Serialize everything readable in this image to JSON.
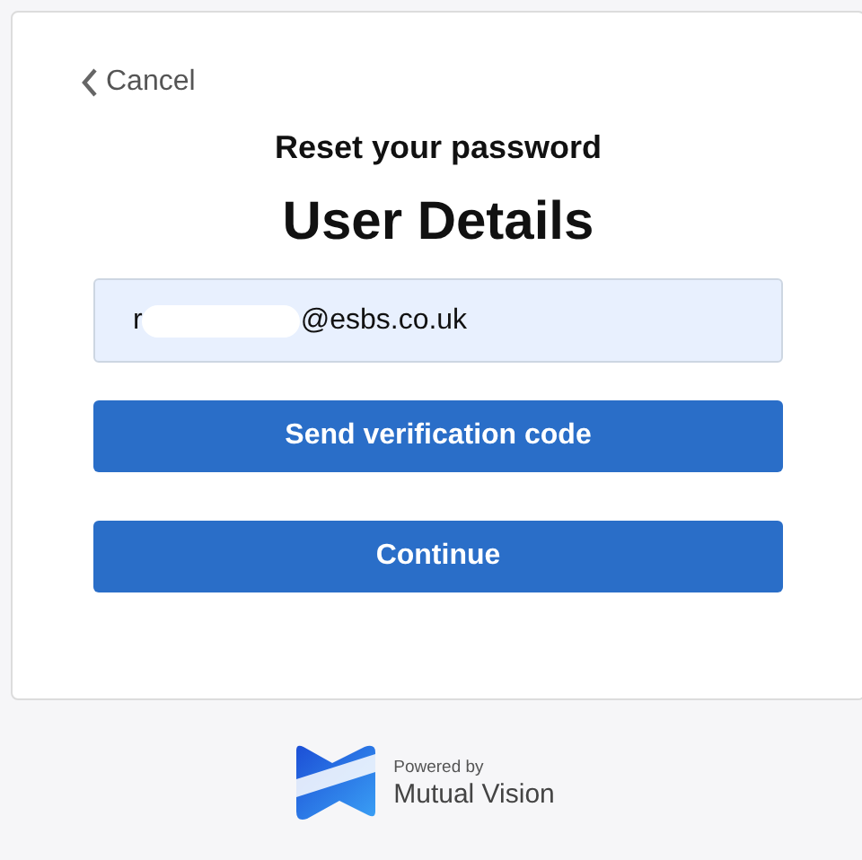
{
  "back_link": {
    "label": "Cancel"
  },
  "subtitle": "Reset your password",
  "heading": "User Details",
  "email_field": {
    "value_start": "r",
    "value_end": "@esbs.co.uk",
    "redacted": true
  },
  "buttons": [
    {
      "label": "Send verification code"
    },
    {
      "label": "Continue"
    }
  ],
  "footer": {
    "tagline": "Powered by",
    "brand": "Mutual Vision"
  }
}
